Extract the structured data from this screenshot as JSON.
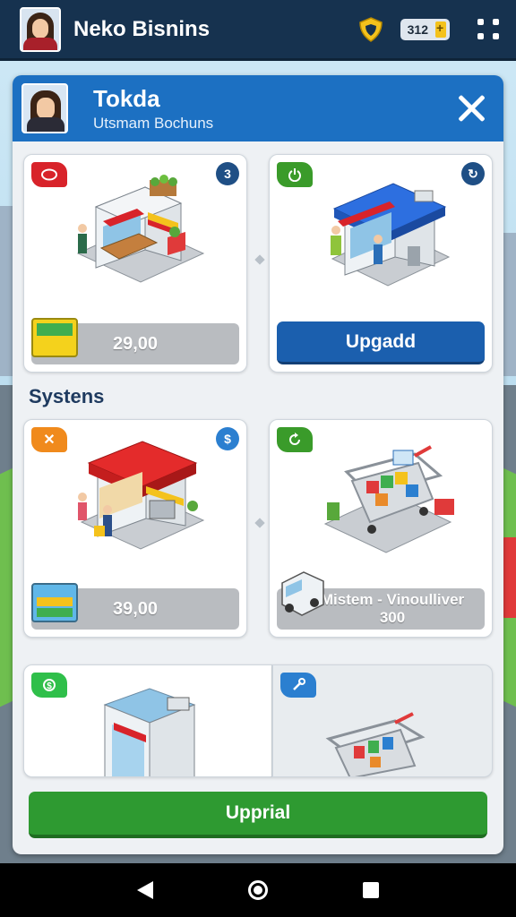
{
  "topbar": {
    "title": "Neko Bisnins",
    "coins": "312",
    "icons": {
      "avatar": "player-avatar",
      "shield": "shield-icon",
      "menu": "grid-menu-icon"
    }
  },
  "panel": {
    "title": "Tokda",
    "subtitle": "Utsmam Bochuns",
    "section_label": "Systens",
    "cards": [
      {
        "tag_icon": "red-oval-icon",
        "badge": "3",
        "price": "29,00",
        "tag_color": "#d8232a",
        "badge_color": "#1f4f85"
      },
      {
        "tag_icon": "power-icon",
        "badge": "↻",
        "button": "Upgadd",
        "tag_color": "#3a9b2a",
        "badge_color": "#1f4f85"
      },
      {
        "tag_icon": "x-icon",
        "tag_text": "✕",
        "badge": "$",
        "price": "39,00",
        "tag_color": "#f08a1c",
        "badge_color": "#2b7fd0"
      },
      {
        "tag_icon": "refresh-icon",
        "badge": "",
        "price_line1": "Mistem - Vinoulliver",
        "price_line2": "300",
        "tag_color": "#3a9b2a"
      },
      {
        "tag_icon": "money-icon",
        "tag_color": "#2fbf4a"
      },
      {
        "tag_icon": "wrench-icon",
        "tag_color": "#2b7fd0"
      }
    ],
    "primary_button": "Upprial"
  },
  "colors": {
    "topbar": "#16324f",
    "panel_header": "#1c70c2",
    "button_blue": "#1b5fae",
    "button_green": "#2e9a31"
  }
}
